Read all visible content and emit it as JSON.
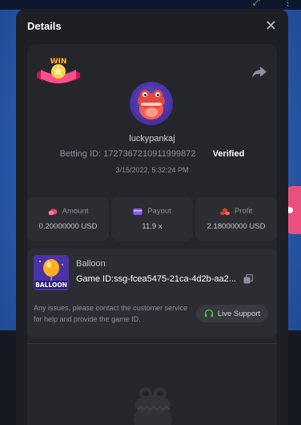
{
  "modal": {
    "title": "Details",
    "close_glyph": "✕"
  },
  "badge": {
    "text": "WIN"
  },
  "user": {
    "username": "luckypankaj",
    "betting_id_label": "Betting ID:",
    "betting_id": "1727367210911999872",
    "verified": "Verified",
    "timestamp": "3/15/2022, 5:32:24 PM"
  },
  "stats": [
    {
      "label": "Amount",
      "value": "0.20000000 USD",
      "icon": "coins-icon",
      "color": "#e2496d"
    },
    {
      "label": "Payout",
      "value": "11.9 x",
      "icon": "card-icon",
      "color": "#8a5cf2"
    },
    {
      "label": "Profit",
      "value": "2.18000000 USD",
      "icon": "stack-icon",
      "color": "#e2402f"
    }
  ],
  "game": {
    "thumb_text": "BALLOON",
    "name": "Balloon",
    "game_id_label": "Game ID:",
    "game_id": "ssg-fcea5475-21ca-4d2b-aa2...",
    "support_text": "Any issues, please contact the customer service for help and provide the game ID.",
    "support_button": "Live Support",
    "support_icon_color": "#3ec23e"
  },
  "colors": {
    "modal_bg": "#1e1f24",
    "panel_bg": "#25262b",
    "card_bg": "#2c2d33",
    "muted_text": "#8d909c"
  }
}
